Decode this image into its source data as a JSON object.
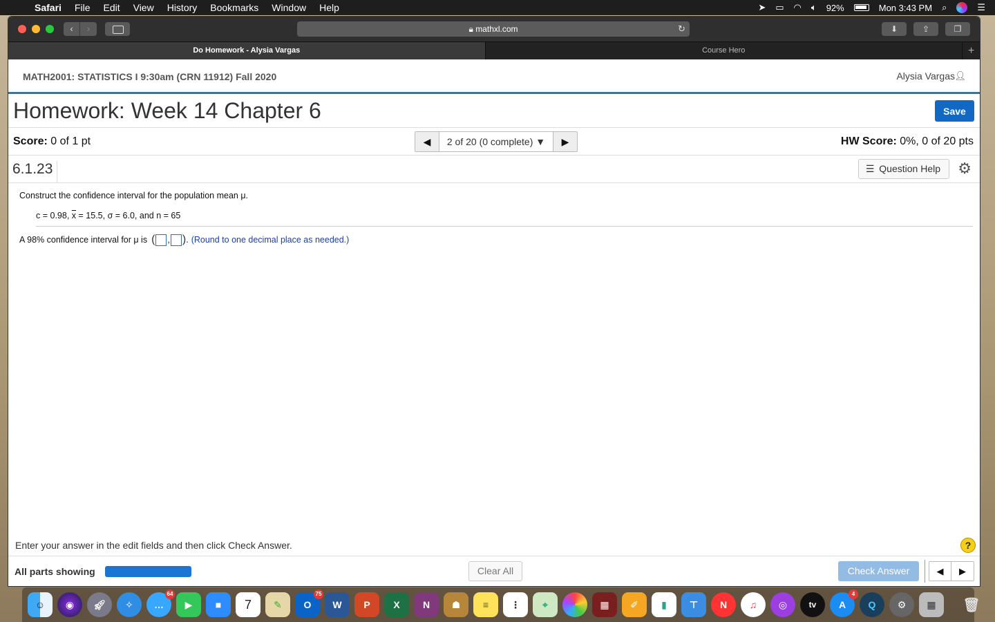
{
  "menubar": {
    "app": "Safari",
    "items": [
      "File",
      "Edit",
      "View",
      "History",
      "Bookmarks",
      "Window",
      "Help"
    ],
    "battery": "92%",
    "clock": "Mon 3:43 PM"
  },
  "browser": {
    "url": "mathxl.com",
    "tabs": [
      {
        "label": "Do Homework - Alysia Vargas",
        "active": true
      },
      {
        "label": "Course Hero",
        "active": false
      }
    ]
  },
  "course": {
    "title": "MATH2001: STATISTICS I 9:30am (CRN 11912) Fall 2020",
    "user": "Alysia Vargas"
  },
  "homework": {
    "title": "Homework: Week 14 Chapter 6",
    "save_label": "Save",
    "score_label": "Score:",
    "score_value": "0 of 1 pt",
    "question_selector": "2 of 20 (0 complete)",
    "hw_score_label": "HW Score:",
    "hw_score_value": "0%, 0 of 20 pts"
  },
  "question": {
    "id": "6.1.23",
    "help_label": "Question Help",
    "prompt": "Construct the confidence interval for the population mean μ.",
    "c": "c = 0.98,",
    "xbar_symbol": "x",
    "xbar": " = 15.5,",
    "sigma_symbol": "σ",
    "sigma": " = 6.0, and n = 65",
    "answer_prefix": "A 98% confidence interval for μ is",
    "answer_hint": "(Round to one decimal place as needed.)"
  },
  "footer": {
    "instruction": "Enter your answer in the edit fields and then click Check Answer.",
    "parts_label": "All parts showing",
    "clear_label": "Clear All",
    "check_label": "Check Answer",
    "help_symbol": "?"
  },
  "dock": {
    "messages_badge": "64",
    "outlook_badge": "75",
    "appstore_badge": "4",
    "calendar_day": "7",
    "appletv_label": "tv"
  }
}
